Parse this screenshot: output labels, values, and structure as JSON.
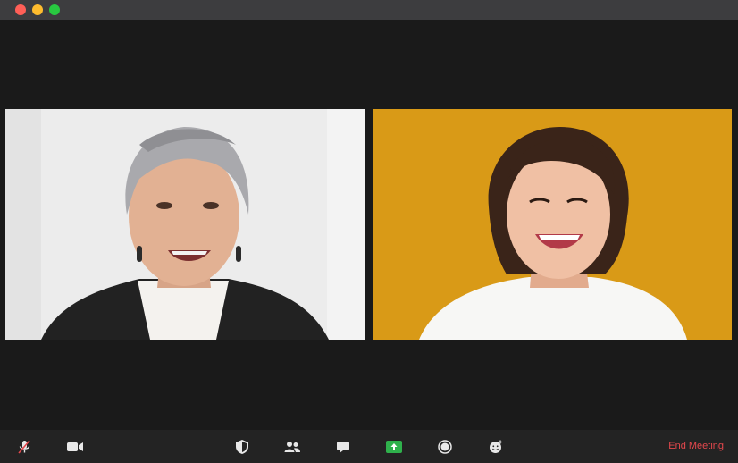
{
  "window": {
    "controls": [
      "close",
      "minimize",
      "zoom"
    ]
  },
  "participants": [
    {
      "background": "#e9e9e9"
    },
    {
      "background": "#d99a17"
    }
  ],
  "toolbar": {
    "icons": [
      "microphone-muted-icon",
      "video-icon",
      "security-shield-icon",
      "participants-icon",
      "chat-icon",
      "share-screen-icon",
      "record-icon",
      "reactions-icon"
    ],
    "share_color": "#2fb14c",
    "end_label": "End Meeting",
    "end_color": "#e5484d"
  }
}
